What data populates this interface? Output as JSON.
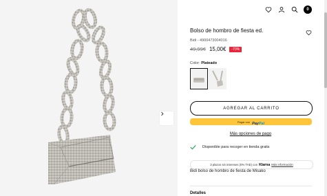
{
  "product": {
    "title": "Bolso de hombro de fiesta ed.",
    "sku": "Bidi - 4900473004016",
    "old_price": "49,99€",
    "price": "15,00€",
    "discount": "-70%",
    "color_label": "Color:",
    "color_value": "Plateado"
  },
  "header": {
    "cart_count": "0"
  },
  "buttons": {
    "add_to_cart": "AGREGAR AL CARRITO",
    "paypal_prefix": "Pagar con",
    "paypal_brand_1": "Pay",
    "paypal_brand_2": "Pal",
    "more_payment": "Más opciones de pago"
  },
  "availability": "Disponible para recoger en tienda gratis",
  "klarna": {
    "text": "3 plazos sin intereses (0% TAE) con",
    "brand": "Klarna",
    "more": "Más información"
  },
  "description": "Bidi bolso de hombro de fiesta de Misako",
  "details_label": "Detalles",
  "colors": {
    "accent": "#111111",
    "discount": "#e8253b",
    "paypal": "#fec43a",
    "available_check": "#27a35a"
  },
  "icons": [
    "heart-icon",
    "user-icon",
    "search-icon",
    "cart-badge",
    "chevron-right-icon",
    "check-icon"
  ]
}
